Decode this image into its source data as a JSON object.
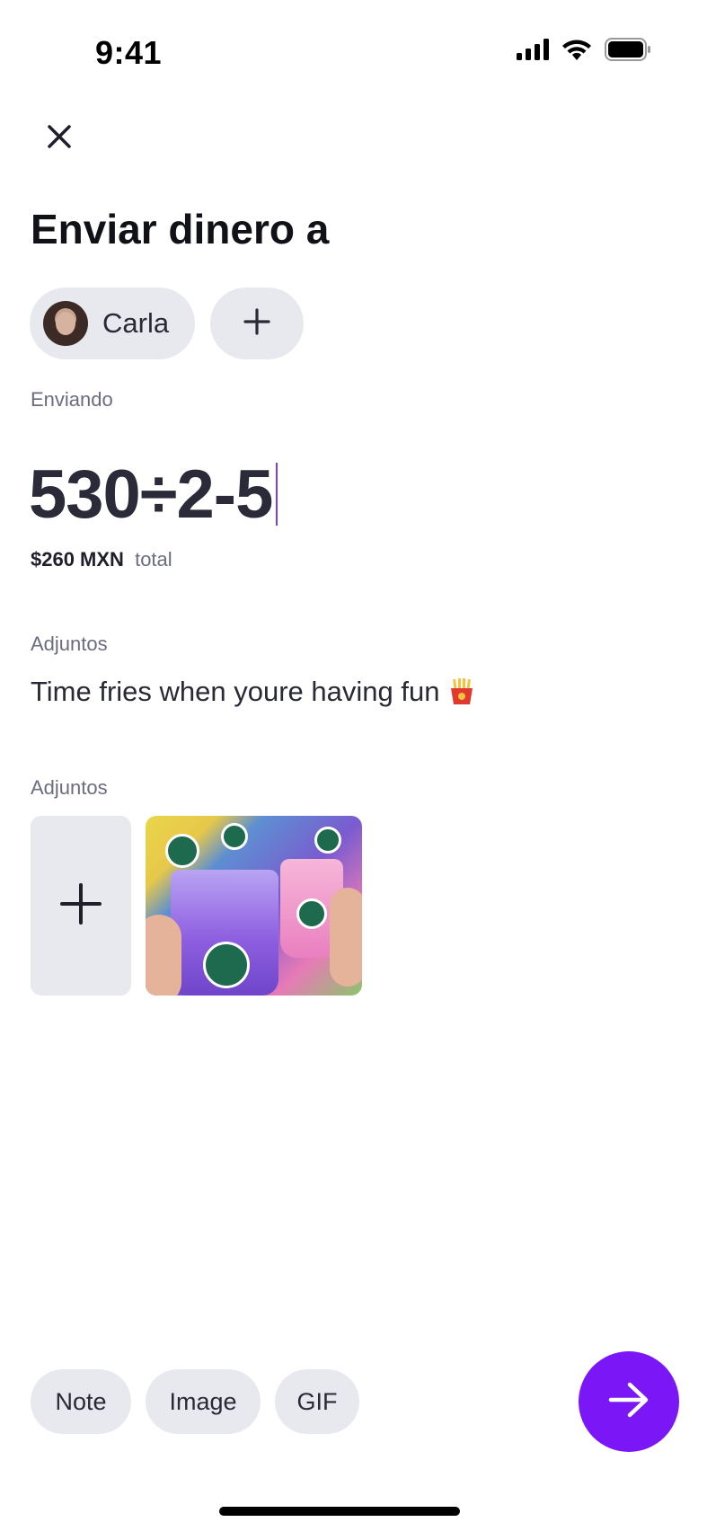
{
  "status_bar": {
    "time": "9:41",
    "icons": [
      "cellular-signal-icon",
      "wifi-icon",
      "battery-icon"
    ]
  },
  "header": {
    "close_icon": "close-icon",
    "title": "Enviar dinero a"
  },
  "recipients": {
    "items": [
      {
        "name": "Carla",
        "avatar": "avatar-photo"
      }
    ],
    "add_icon": "plus-icon"
  },
  "amount": {
    "label": "Enviando",
    "expression": "530÷2-5",
    "total_amount": "$260 MXN",
    "total_word": "total"
  },
  "note": {
    "label": "Adjuntos",
    "text": "Time fries when youre having fun",
    "emoji_icon": "french-fries-icon"
  },
  "attachments": {
    "label": "Adjuntos",
    "add_icon": "plus-icon",
    "items": [
      {
        "kind": "image",
        "description_icon": "photo-thumbnail"
      }
    ]
  },
  "actions": {
    "note_label": "Note",
    "image_label": "Image",
    "gif_label": "GIF",
    "send_icon": "arrow-right-icon"
  },
  "colors": {
    "accent": "#7b16f6",
    "chip_bg": "#e8e8ef",
    "label": "#6c6c80",
    "text": "#2a2a36"
  }
}
